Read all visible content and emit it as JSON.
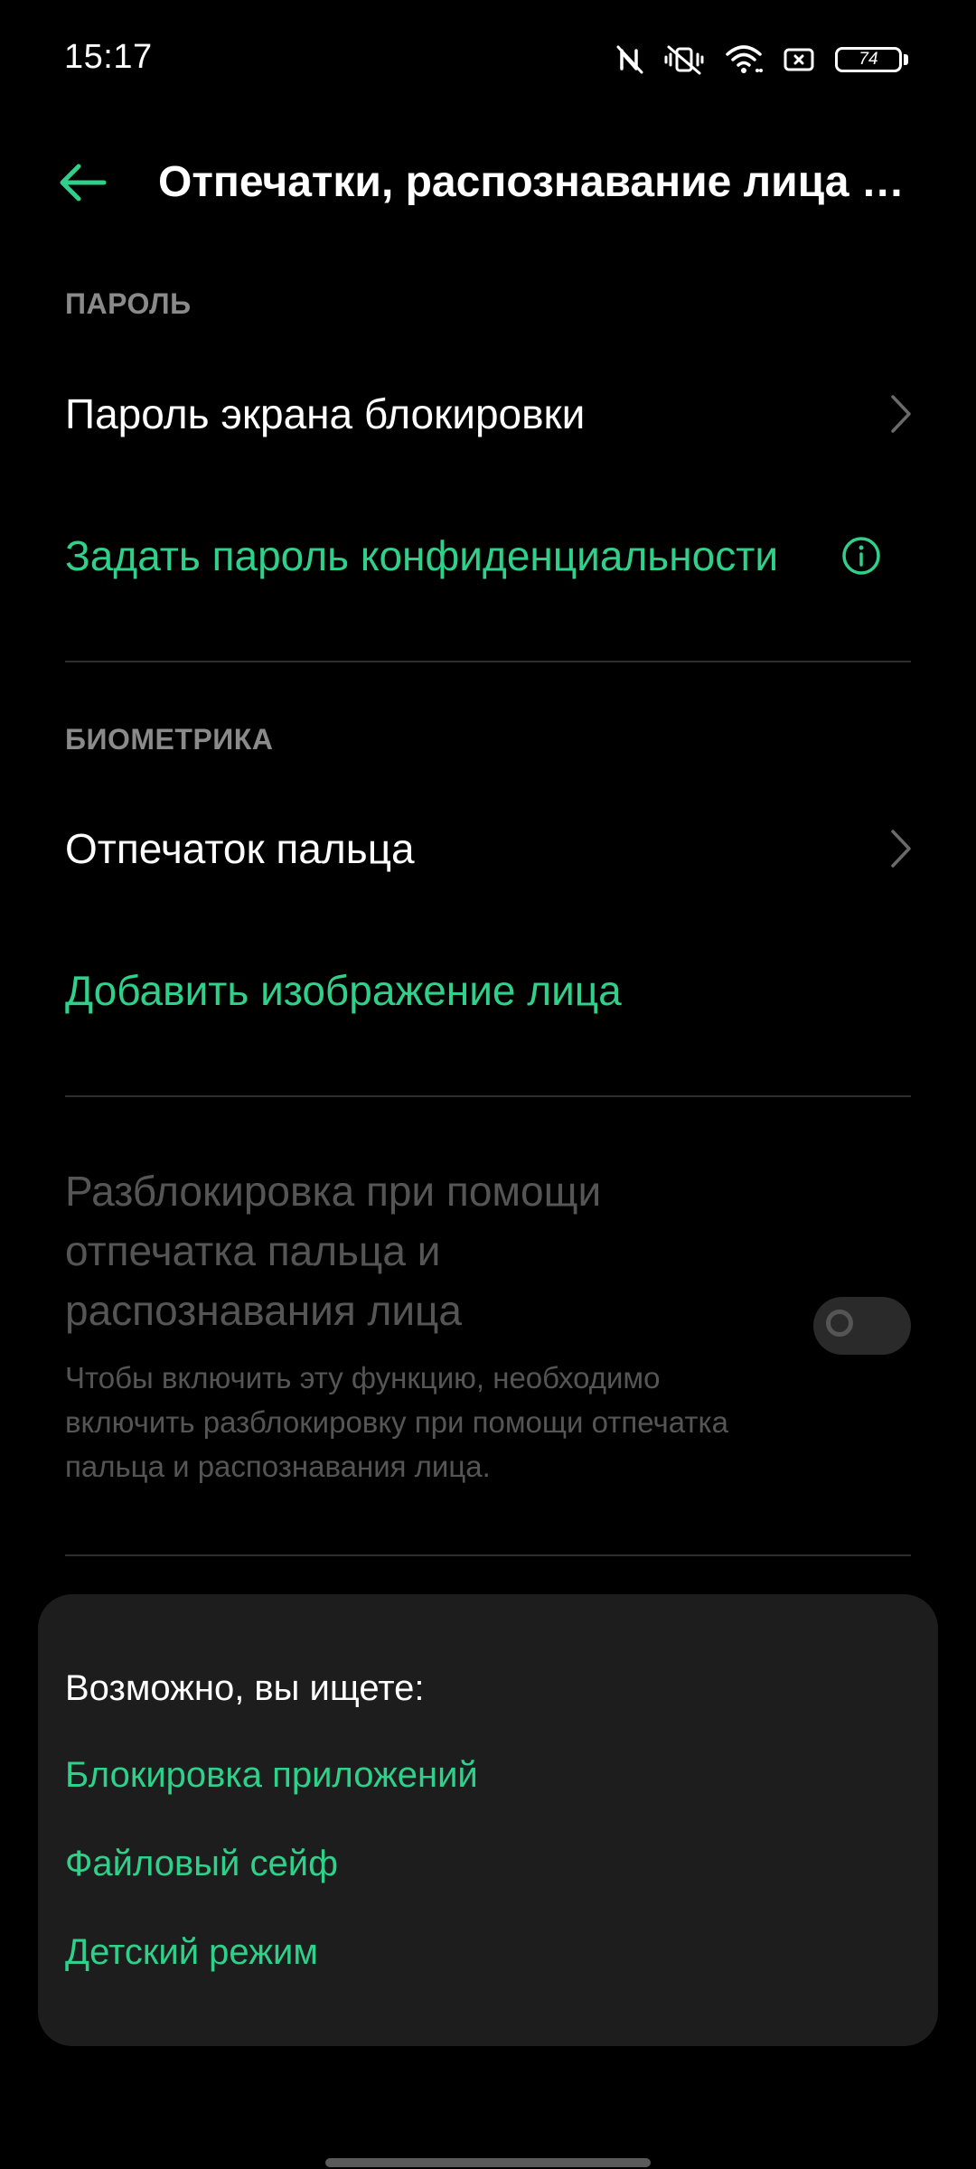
{
  "status_bar": {
    "time": "15:17",
    "battery": "74",
    "icons": [
      "nfc-off-icon",
      "vibrate-mute-icon",
      "wifi-icon",
      "screen-cast-icon",
      "battery-icon"
    ]
  },
  "header": {
    "title": "Отпечатки, распознавание лица и..."
  },
  "sections": {
    "password": {
      "header": "ПАРОЛЬ",
      "lock_screen_password": "Пароль экрана блокировки",
      "privacy_password": "Задать пароль конфиденциальности"
    },
    "biometrics": {
      "header": "БИОМЕТРИКА",
      "fingerprint": "Отпечаток пальца",
      "add_face": "Добавить изображение лица"
    },
    "combined_unlock": {
      "title": "Разблокировка при помощи отпечатка пальца и распознавания лица",
      "description": "Чтобы включить эту функцию, необходимо включить разблокировку при помощи отпечатка пальца и распознавания лица.",
      "enabled": false
    }
  },
  "suggestions": {
    "title": "Возможно, вы ищете:",
    "items": [
      "Блокировка приложений",
      "Файловый сейф",
      "Детский режим"
    ]
  },
  "colors": {
    "accent": "#2fd08a",
    "background": "#000000",
    "card": "#1d1d1d",
    "disabled_text": "#555555"
  }
}
